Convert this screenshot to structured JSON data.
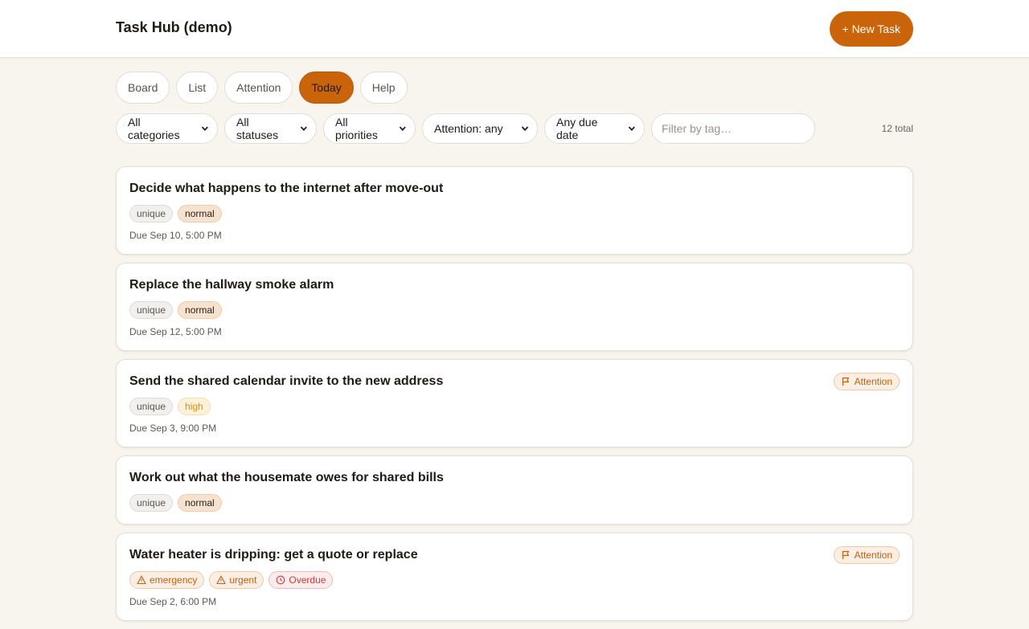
{
  "header": {
    "title": "Task Hub (demo)",
    "new_task_label": "+ New Task"
  },
  "tabs": [
    {
      "label": "Board",
      "active": false
    },
    {
      "label": "List",
      "active": false
    },
    {
      "label": "Attention",
      "active": false
    },
    {
      "label": "Today",
      "active": true
    },
    {
      "label": "Help",
      "active": false
    }
  ],
  "filters": {
    "category": "All categories",
    "status": "All statuses",
    "priority": "All priorities",
    "attention": "Attention: any",
    "due": "Any due date",
    "tag_placeholder": "Filter by tag…",
    "tag_value": "",
    "total": "12 total"
  },
  "tasks": [
    {
      "title": "Decide what happens to the internet after move-out",
      "chips": [
        "unique",
        "normal"
      ],
      "due": "Due Sep 10, 5:00 PM"
    },
    {
      "title": "Replace the hallway smoke alarm",
      "chips": [
        "unique",
        "normal"
      ],
      "due": "Due Sep 12, 5:00 PM"
    },
    {
      "title": "Send the shared calendar invite to the new address",
      "chips": [
        "unique",
        "high"
      ],
      "due": "Due Sep 3, 9:00 PM",
      "attention": "Attention"
    },
    {
      "title": "Work out what the housemate owes for shared bills",
      "chips": [
        "unique",
        "normal"
      ]
    },
    {
      "title": "Water heater is dripping: get a quote or replace",
      "chips": [
        "emergency",
        "urgent",
        "Overdue"
      ],
      "due": "Due Sep 2, 6:00 PM",
      "attention": "Attention"
    }
  ],
  "colors": {
    "accent": "#c9640a",
    "background": "#f8f4ee",
    "overdue": "#d23a3a"
  },
  "icons": {
    "chip_emergency": "warning-triangle-icon",
    "chip_urgent": "warning-triangle-icon",
    "chip_overdue": "clock-icon",
    "attention": "flag-icon"
  }
}
